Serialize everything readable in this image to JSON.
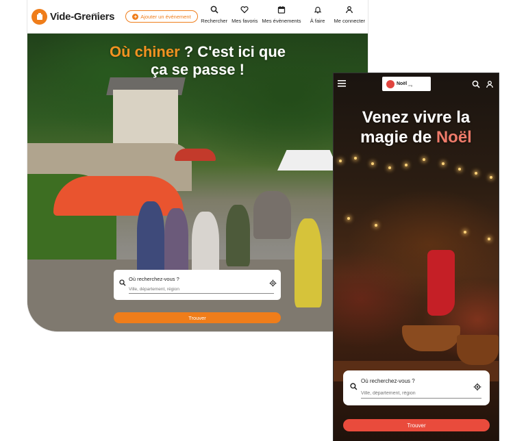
{
  "desktop": {
    "logo": {
      "text": "Vide-Greniers",
      "suffix": ".org"
    },
    "add_event_label": "Ajouter un événement",
    "nav": [
      {
        "label": "Rechercher",
        "icon": "search-icon"
      },
      {
        "label": "Mes favoris",
        "icon": "heart-icon"
      },
      {
        "label": "Mes évènements",
        "icon": "calendar-icon"
      },
      {
        "label": "À faire",
        "icon": "bell-icon"
      },
      {
        "label": "Me connecter",
        "icon": "user-icon"
      }
    ],
    "hero": {
      "title_highlight": "Où chiner",
      "title_rest": " ? C'est ici que",
      "title_line2": "ça se passe !"
    },
    "search": {
      "label": "Où recherchez-vous ?",
      "placeholder": "Ville, département, région",
      "button": "Trouver"
    },
    "colors": {
      "accent": "#ef7d1a"
    }
  },
  "mobile": {
    "logo": {
      "text": "Noël",
      "suffix": ".org"
    },
    "hero": {
      "title_line1": "Venez vivre la",
      "title_line2_prefix": "magie de ",
      "title_highlight": "Noël"
    },
    "search": {
      "label": "Où recherchez-vous ?",
      "placeholder": "Ville, département, région",
      "button": "Trouver"
    },
    "colors": {
      "accent": "#e94b3c"
    }
  }
}
